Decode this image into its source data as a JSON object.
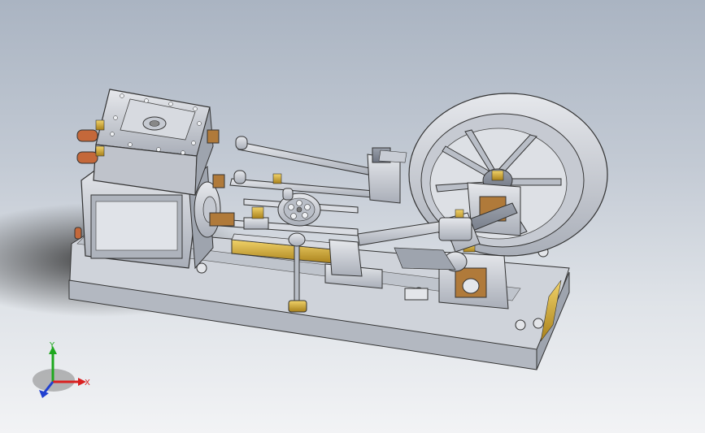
{
  "triad": {
    "x_label": "X",
    "y_label": "Y",
    "x_color": "#d92020",
    "y_color": "#1ea81e",
    "z_color": "#2040d0"
  },
  "colors": {
    "background_top": "#aab4c2",
    "background_bottom": "#f2f3f5",
    "metal": "#c8ccd4",
    "brass": "#c9a227",
    "copper": "#c4683a"
  }
}
